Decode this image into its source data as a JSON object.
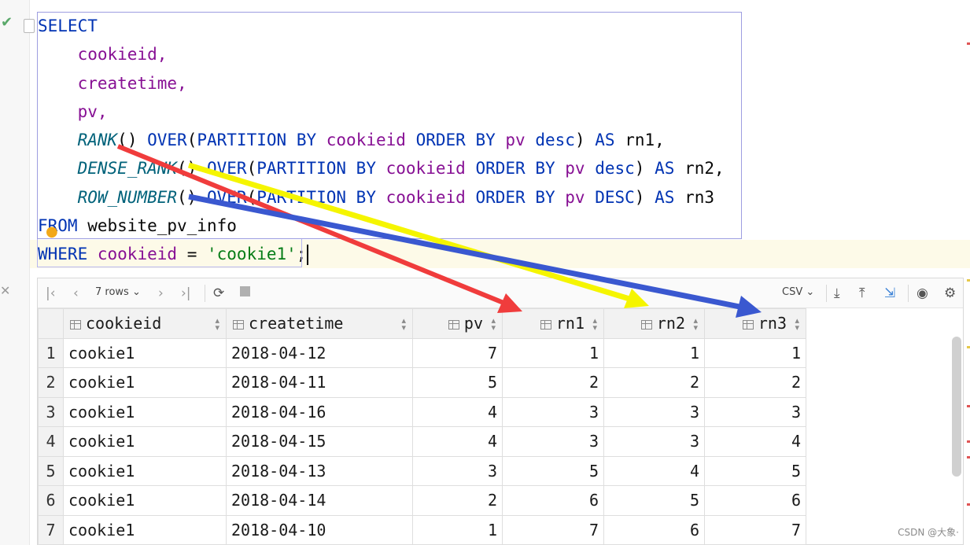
{
  "editor": {
    "lines": [
      "SELECT",
      "cookieid,",
      "createtime,",
      "pv,",
      "RANK() OVER(PARTITION BY cookieid ORDER BY pv desc) AS rn1,",
      "DENSE_RANK() OVER(PARTITION BY cookieid ORDER BY pv desc) AS rn2,",
      "ROW_NUMBER() OVER(PARTITION BY cookieid ORDER BY pv DESC) AS rn3",
      "FROM website_pv_info",
      "WHERE cookieid = 'cookie1';"
    ]
  },
  "toolbar": {
    "rows_label": "7 rows",
    "csv_label": "CSV",
    "icons": [
      "first-page-icon",
      "prev-page-icon",
      "next-page-icon",
      "last-page-icon",
      "refresh-icon",
      "stop-icon",
      "download-icon",
      "upload-icon",
      "compare-icon",
      "view-icon",
      "settings-icon"
    ]
  },
  "table": {
    "columns": [
      "cookieid",
      "createtime",
      "pv",
      "rn1",
      "rn2",
      "rn3"
    ],
    "rows": [
      [
        "1",
        "cookie1",
        "2018-04-12",
        "7",
        "1",
        "1",
        "1"
      ],
      [
        "2",
        "cookie1",
        "2018-04-11",
        "5",
        "2",
        "2",
        "2"
      ],
      [
        "3",
        "cookie1",
        "2018-04-16",
        "4",
        "3",
        "3",
        "3"
      ],
      [
        "4",
        "cookie1",
        "2018-04-15",
        "4",
        "3",
        "3",
        "4"
      ],
      [
        "5",
        "cookie1",
        "2018-04-13",
        "3",
        "5",
        "4",
        "5"
      ],
      [
        "6",
        "cookie1",
        "2018-04-14",
        "2",
        "6",
        "5",
        "6"
      ],
      [
        "7",
        "cookie1",
        "2018-04-10",
        "1",
        "7",
        "6",
        "7"
      ]
    ]
  },
  "annotation_colors": {
    "rank_arrow": "#f03c3c",
    "dense_rank_arrow": "#f5f500",
    "row_number_arrow": "#3a58d0"
  },
  "syntax_colors": {
    "keyword": "#0033b3",
    "column": "#871094",
    "function": "#00627a",
    "string": "#067d17"
  },
  "watermark": "CSDN @大象·"
}
